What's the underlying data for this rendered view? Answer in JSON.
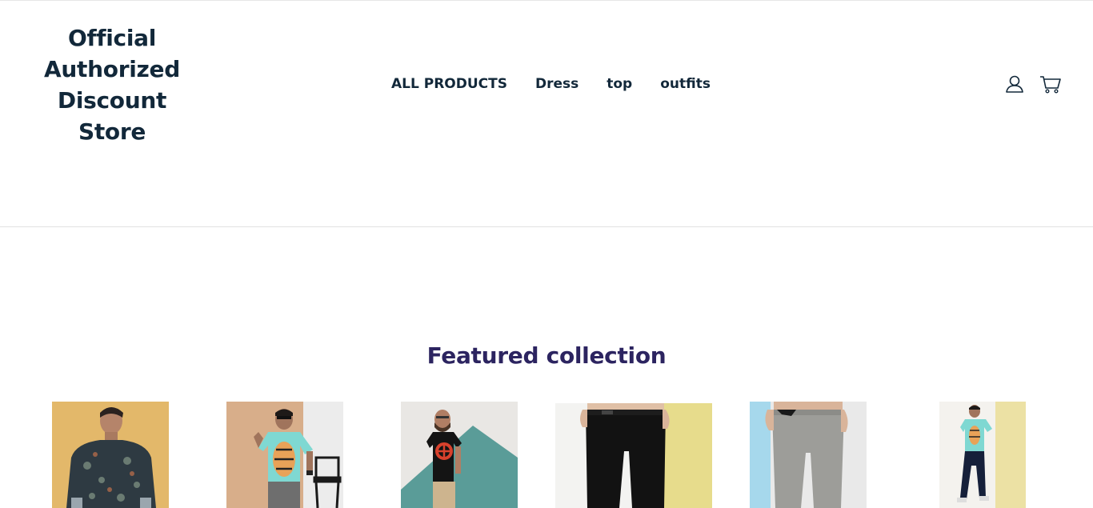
{
  "header": {
    "logo_lines": [
      "Official",
      "Authorized",
      "Discount",
      "Store"
    ]
  },
  "nav": {
    "items": [
      {
        "label": "ALL PRODUCTS"
      },
      {
        "label": "Dress"
      },
      {
        "label": "top"
      },
      {
        "label": "outfits"
      }
    ]
  },
  "icons": {
    "account": "user-icon",
    "cart": "cart-icon"
  },
  "featured": {
    "title": "Featured collection",
    "products": [
      {
        "image": "floral-shirt-model",
        "bg": "#e3b86a"
      },
      {
        "image": "tiger-tee-model-chair",
        "bg": "#d9b08c"
      },
      {
        "image": "black-tee-model-teal",
        "bg": "#e9e7e4"
      },
      {
        "image": "black-trousers",
        "bg": "#e7dc8c"
      },
      {
        "image": "grey-trousers",
        "bg": "#e9e9e9"
      },
      {
        "image": "tiger-tee-full-length",
        "bg": "#f1ecd0"
      }
    ]
  },
  "colors": {
    "heading": "#12283a",
    "featured_title": "#2c2460",
    "divider": "#e2e2e2"
  }
}
